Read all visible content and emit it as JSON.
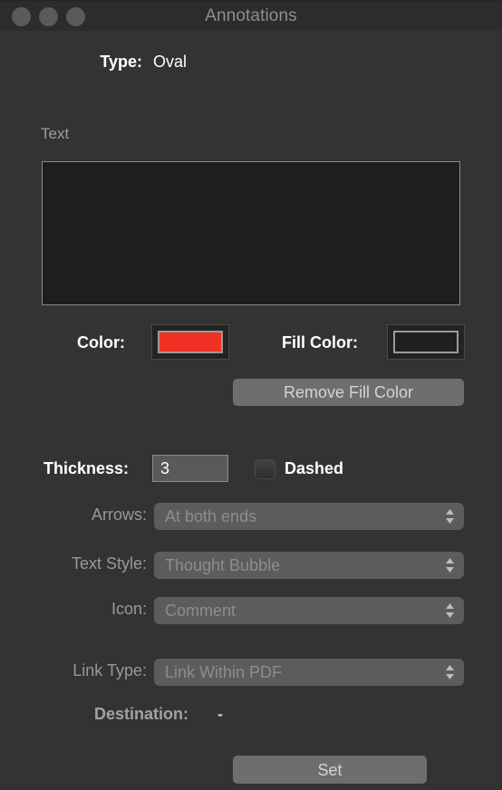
{
  "window": {
    "title": "Annotations",
    "traffic_lights": [
      "close",
      "minimize",
      "zoom"
    ]
  },
  "type_row": {
    "label": "Type:",
    "value": "Oval"
  },
  "text_section": {
    "label": "Text",
    "value": "",
    "placeholder": ""
  },
  "color_section": {
    "color_label": "Color:",
    "color_value": "#ee3124",
    "fill_label": "Fill Color:",
    "fill_value": "none",
    "remove_fill_label": "Remove Fill Color"
  },
  "stroke_section": {
    "thickness_label": "Thickness:",
    "thickness_value": "3",
    "dashed_label": "Dashed",
    "dashed_checked": false
  },
  "popups": [
    {
      "label": "Arrows:",
      "value": "At both ends",
      "icon": "chevron-updown-icon",
      "disabled": true
    },
    {
      "label": "Text Style:",
      "value": "Thought Bubble",
      "icon": "chevron-updown-icon",
      "disabled": true
    },
    {
      "label": "Icon:",
      "value": "Comment",
      "icon": "chevron-updown-icon",
      "disabled": true
    },
    {
      "label": "Link Type:",
      "value": "Link Within PDF",
      "icon": "chevron-updown-icon",
      "disabled": true
    }
  ],
  "destination": {
    "label": "Destination:",
    "value": "-"
  },
  "footer": {
    "set_label": "Set"
  },
  "colors": {
    "window_bg": "#333333",
    "titlebar_bg": "#2c2c2c",
    "accent_red": "#ee3124",
    "button_gray": "#6e6e6e",
    "field_gray": "#595959",
    "disabled_text": "#8d8d8d"
  }
}
